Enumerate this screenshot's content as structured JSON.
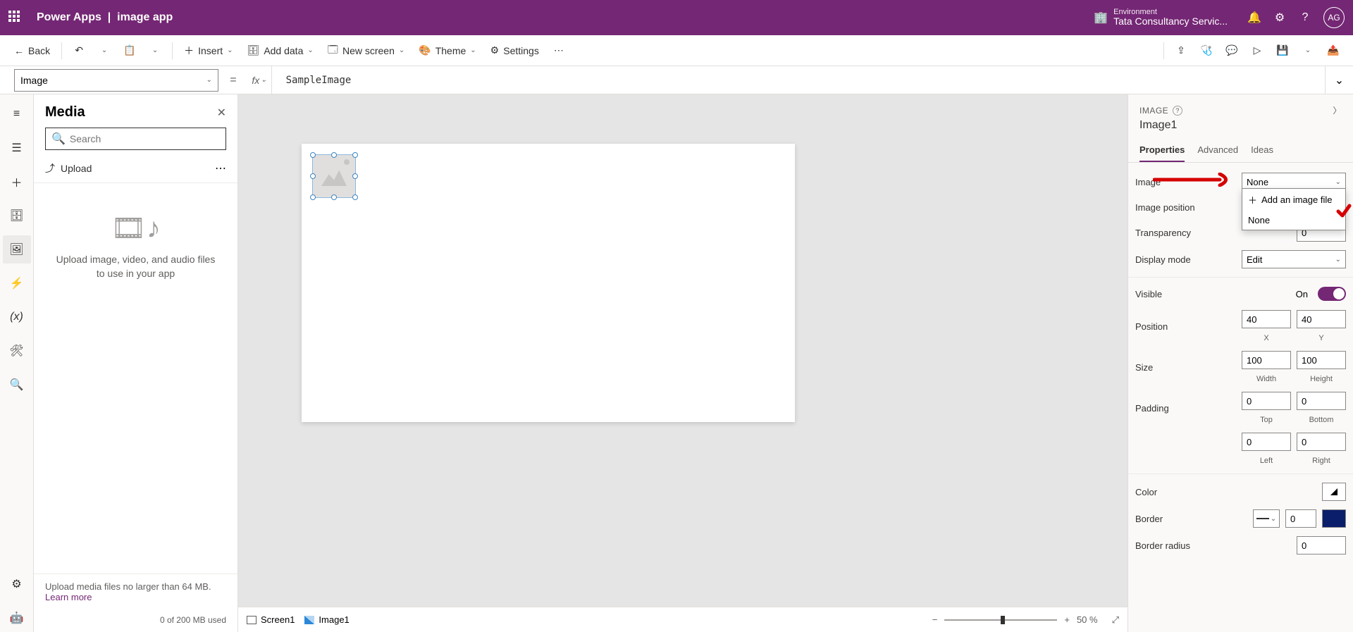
{
  "header": {
    "app_name": "Power Apps",
    "file_name": "image app",
    "env_label": "Environment",
    "env_name": "Tata Consultancy Servic...",
    "avatar": "AG"
  },
  "cmdbar": {
    "back": "Back",
    "insert": "Insert",
    "add_data": "Add data",
    "new_screen": "New screen",
    "theme": "Theme",
    "settings": "Settings"
  },
  "formula": {
    "property": "Image",
    "value": "SampleImage"
  },
  "media": {
    "title": "Media",
    "search_placeholder": "Search",
    "upload": "Upload",
    "empty_text": "Upload image, video, and audio files to use in your app",
    "footer_line": "Upload media files no larger than 64 MB.",
    "learn_more": "Learn more",
    "usage": "0 of 200 MB used"
  },
  "breadcrumb": {
    "screen": "Screen1",
    "control": "Image1",
    "zoom": "50  %"
  },
  "props": {
    "type_label": "IMAGE",
    "control_name": "Image1",
    "tabs": {
      "properties": "Properties",
      "advanced": "Advanced",
      "ideas": "Ideas"
    },
    "image_label": "Image",
    "image_value": "None",
    "image_dropdown": {
      "add": "Add an image file",
      "none": "None"
    },
    "image_position_label": "Image position",
    "transparency_label": "Transparency",
    "transparency_value": "0",
    "display_mode_label": "Display mode",
    "display_mode_value": "Edit",
    "visible_label": "Visible",
    "visible_value": "On",
    "position_label": "Position",
    "pos_x": "40",
    "pos_y": "40",
    "pos_x_sub": "X",
    "pos_y_sub": "Y",
    "size_label": "Size",
    "size_w": "100",
    "size_h": "100",
    "size_w_sub": "Width",
    "size_h_sub": "Height",
    "padding_label": "Padding",
    "pad_t": "0",
    "pad_b": "0",
    "pad_l": "0",
    "pad_r": "0",
    "pad_t_sub": "Top",
    "pad_b_sub": "Bottom",
    "pad_l_sub": "Left",
    "pad_r_sub": "Right",
    "color_label": "Color",
    "border_label": "Border",
    "border_value": "0",
    "border_radius_label": "Border radius",
    "border_radius_value": "0"
  }
}
